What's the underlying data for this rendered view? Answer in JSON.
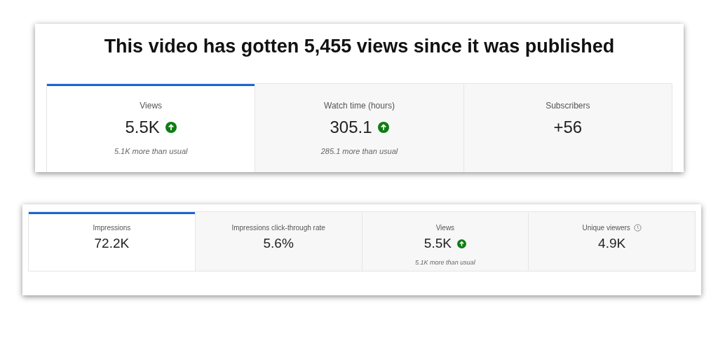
{
  "summary": {
    "headline": "This video has gotten 5,455 views since it was published",
    "tabs": [
      {
        "label": "Views",
        "value": "5.5K",
        "trend_up": true,
        "note": "5.1K more than usual",
        "selected": true
      },
      {
        "label": "Watch time (hours)",
        "value": "305.1",
        "trend_up": true,
        "note": "285.1 more than usual",
        "selected": false
      },
      {
        "label": "Subscribers",
        "value": "+56",
        "trend_up": false,
        "selected": false
      }
    ]
  },
  "reach": {
    "tabs": [
      {
        "label": "Impressions",
        "value": "72.2K",
        "trend_up": false,
        "info": false,
        "selected": true
      },
      {
        "label": "Impressions click-through rate",
        "value": "5.6%",
        "trend_up": false,
        "info": false,
        "selected": false
      },
      {
        "label": "Views",
        "value": "5.5K",
        "trend_up": true,
        "info": false,
        "note": "5.1K more than usual",
        "selected": false
      },
      {
        "label": "Unique viewers",
        "value": "4.9K",
        "trend_up": false,
        "info": true,
        "selected": false
      }
    ]
  }
}
